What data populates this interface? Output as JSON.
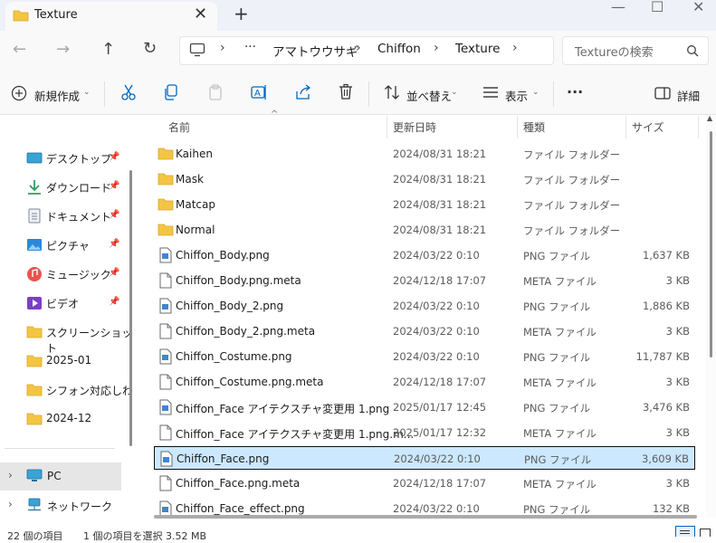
{
  "window": {
    "tab_title": "Texture",
    "close_glyph": "✕",
    "new_tab_glyph": "+",
    "minimize_glyph": "—",
    "maximize_glyph": "☐",
    "winclose_glyph": "✕"
  },
  "nav": {
    "back": "←",
    "forward": "→",
    "up": "↑",
    "refresh": "↻",
    "more": "···",
    "breadcrumbs": [
      "アマトウウサギ",
      "Chiffon",
      "Texture"
    ],
    "sep": "›",
    "search_placeholder": "Textureの検索"
  },
  "toolbar": {
    "new_label": "新規作成",
    "sort_label": "並べ替え",
    "view_label": "表示",
    "more_label": "···",
    "details_label": "詳細"
  },
  "sidebar": {
    "items": [
      {
        "label": "デスクトップ",
        "icon": "desktop-icon",
        "pinned": true
      },
      {
        "label": "ダウンロード",
        "icon": "download-icon",
        "pinned": true
      },
      {
        "label": "ドキュメント",
        "icon": "document-icon",
        "pinned": true
      },
      {
        "label": "ピクチャ",
        "icon": "pictures-icon",
        "pinned": true
      },
      {
        "label": "ミュージック",
        "icon": "music-icon",
        "pinned": true
      },
      {
        "label": "ビデオ",
        "icon": "video-icon",
        "pinned": true
      },
      {
        "label": "スクリーンショット",
        "icon": "folder-icon",
        "pinned": false
      },
      {
        "label": "2025-01",
        "icon": "folder-icon",
        "pinned": false
      },
      {
        "label": "シフォン対応しわ",
        "icon": "folder-icon",
        "pinned": false
      },
      {
        "label": "2024-12",
        "icon": "folder-icon",
        "pinned": false
      }
    ],
    "pc_label": "PC",
    "network_label": "ネットワーク"
  },
  "columns": {
    "name": "名前",
    "modified": "更新日時",
    "type": "種類",
    "size": "サイズ"
  },
  "files": [
    {
      "name": "Kaihen",
      "modified": "2024/08/31 18:21",
      "type": "ファイル フォルダー",
      "size": "",
      "kind": "folder"
    },
    {
      "name": "Mask",
      "modified": "2024/08/31 18:21",
      "type": "ファイル フォルダー",
      "size": "",
      "kind": "folder"
    },
    {
      "name": "Matcap",
      "modified": "2024/08/31 18:21",
      "type": "ファイル フォルダー",
      "size": "",
      "kind": "folder"
    },
    {
      "name": "Normal",
      "modified": "2024/08/31 18:21",
      "type": "ファイル フォルダー",
      "size": "",
      "kind": "folder"
    },
    {
      "name": "Chiffon_Body.png",
      "modified": "2024/03/22 0:10",
      "type": "PNG ファイル",
      "size": "1,637 KB",
      "kind": "png"
    },
    {
      "name": "Chiffon_Body.png.meta",
      "modified": "2024/12/18 17:07",
      "type": "META ファイル",
      "size": "3 KB",
      "kind": "file"
    },
    {
      "name": "Chiffon_Body_2.png",
      "modified": "2024/03/22 0:10",
      "type": "PNG ファイル",
      "size": "1,886 KB",
      "kind": "png"
    },
    {
      "name": "Chiffon_Body_2.png.meta",
      "modified": "2024/03/22 0:10",
      "type": "META ファイル",
      "size": "3 KB",
      "kind": "file"
    },
    {
      "name": "Chiffon_Costume.png",
      "modified": "2024/03/22 0:10",
      "type": "PNG ファイル",
      "size": "11,787 KB",
      "kind": "png"
    },
    {
      "name": "Chiffon_Costume.png.meta",
      "modified": "2024/12/18 17:07",
      "type": "META ファイル",
      "size": "3 KB",
      "kind": "file"
    },
    {
      "name": "Chiffon_Face アイテクスチャ変更用 1.png",
      "modified": "2025/01/17 12:45",
      "type": "PNG ファイル",
      "size": "3,476 KB",
      "kind": "png"
    },
    {
      "name": "Chiffon_Face アイテクスチャ変更用 1.png.m...",
      "modified": "2025/01/17 12:32",
      "type": "META ファイル",
      "size": "3 KB",
      "kind": "file"
    },
    {
      "name": "Chiffon_Face.png",
      "modified": "2024/03/22 0:10",
      "type": "PNG ファイル",
      "size": "3,609 KB",
      "kind": "png",
      "selected": true
    },
    {
      "name": "Chiffon_Face.png.meta",
      "modified": "2024/12/18 17:07",
      "type": "META ファイル",
      "size": "3 KB",
      "kind": "file"
    },
    {
      "name": "Chiffon_Face_effect.png",
      "modified": "2024/03/22 0:10",
      "type": "PNG ファイル",
      "size": "132 KB",
      "kind": "png"
    }
  ],
  "status": {
    "count": "22 個の項目",
    "selection": "1 個の項目を選択 3.52 MB"
  },
  "colors": {
    "folder": "#f4c542",
    "accent": "#0067c0",
    "selected_bg": "#cce8ff",
    "sidebar_pc_bg": "#e6e6e6"
  }
}
